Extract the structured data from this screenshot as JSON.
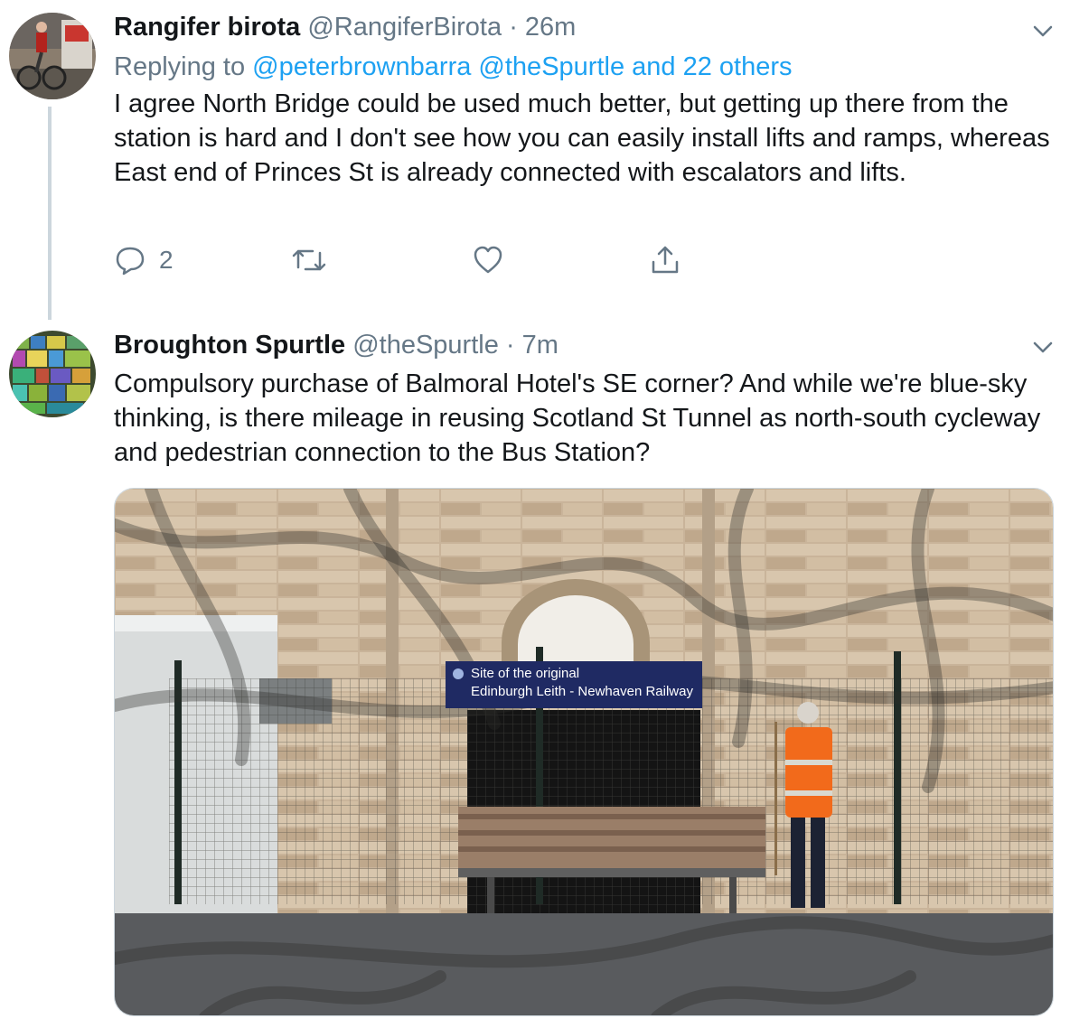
{
  "tweets": [
    {
      "name": "Rangifer birota",
      "handle": "@RangiferBirota",
      "separator": "·",
      "time": "26m",
      "replying_prefix": "Replying to",
      "replying_mentions": "@peterbrownbarra @theSpurtle and 22 others",
      "text": "I agree North Bridge could be used much better, but getting up there from the station is hard and I don't see how you can easily install lifts and ramps, whereas East end of Princes St is already connected with escalators and lifts.",
      "reply_count": "2",
      "avatar_icon": "cyclist-avatar",
      "actions": [
        "reply-icon",
        "retweet-icon",
        "like-icon",
        "share-icon"
      ]
    },
    {
      "name": "Broughton Spurtle",
      "handle": "@theSpurtle",
      "separator": "·",
      "time": "7m",
      "text": "Compulsory purchase of Balmoral Hotel's SE corner? And while we're blue-sky thinking, is there mileage in reusing Scotland St Tunnel as north-south cycleway and pedestrian connection to the Bus Station?",
      "avatar_icon": "colorful-grid-avatar",
      "image": {
        "sign_line1": "Site of the original",
        "sign_line2": "Edinburgh Leith - Newhaven Railway"
      }
    }
  ],
  "colors": {
    "text": "#14171a",
    "secondary": "#657786",
    "link": "#1da1f2",
    "thread_line": "#ccd6dd",
    "vest": "#f26a1b",
    "sign": "#1f2a63"
  }
}
